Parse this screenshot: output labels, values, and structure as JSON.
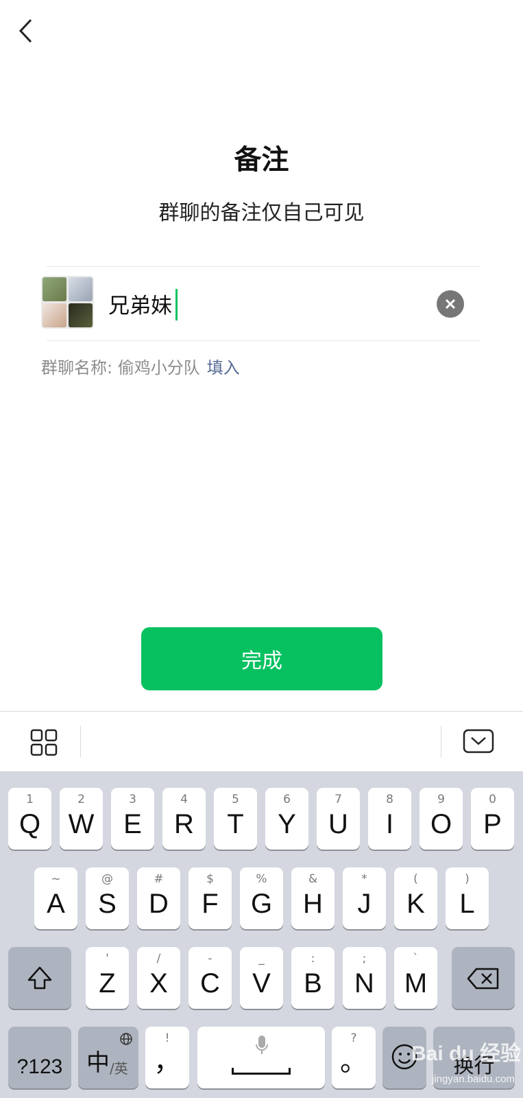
{
  "page": {
    "title": "备注",
    "subtitle": "群聊的备注仅自己可见"
  },
  "remark": {
    "value": "兄弟妹",
    "placeholder": ""
  },
  "hint": {
    "label": "群聊名称: 偷鸡小分队",
    "action": "填入"
  },
  "done_label": "完成",
  "colors": {
    "accent": "#07c160",
    "link": "#576b95",
    "keyboard_bg": "#d4d7df"
  },
  "keyboard": {
    "row1": [
      {
        "sub": "1",
        "main": "Q"
      },
      {
        "sub": "2",
        "main": "W"
      },
      {
        "sub": "3",
        "main": "E"
      },
      {
        "sub": "4",
        "main": "R"
      },
      {
        "sub": "5",
        "main": "T"
      },
      {
        "sub": "6",
        "main": "Y"
      },
      {
        "sub": "7",
        "main": "U"
      },
      {
        "sub": "8",
        "main": "I"
      },
      {
        "sub": "9",
        "main": "O"
      },
      {
        "sub": "0",
        "main": "P"
      }
    ],
    "row2": [
      {
        "sub": "~",
        "main": "A"
      },
      {
        "sub": "@",
        "main": "S"
      },
      {
        "sub": "#",
        "main": "D"
      },
      {
        "sub": "$",
        "main": "F"
      },
      {
        "sub": "%",
        "main": "G"
      },
      {
        "sub": "&",
        "main": "H"
      },
      {
        "sub": "*",
        "main": "J"
      },
      {
        "sub": "(",
        "main": "K"
      },
      {
        "sub": ")",
        "main": "L"
      }
    ],
    "row3": [
      {
        "sub": "'",
        "main": "Z"
      },
      {
        "sub": "/",
        "main": "X"
      },
      {
        "sub": "-",
        "main": "C"
      },
      {
        "sub": "_",
        "main": "V"
      },
      {
        "sub": ":",
        "main": "B"
      },
      {
        "sub": ";",
        "main": "N"
      },
      {
        "sub": "`",
        "main": "M"
      }
    ],
    "numbers_label": "?123",
    "lang_main": "中",
    "lang_sub": "/英",
    "excl_sub": "!",
    "excl_main": "，",
    "period_sub": "?",
    "period_main": "。",
    "return_label": "换行"
  },
  "watermark": {
    "text": "Bai du 经验",
    "url": "jingyan.baidu.com"
  }
}
